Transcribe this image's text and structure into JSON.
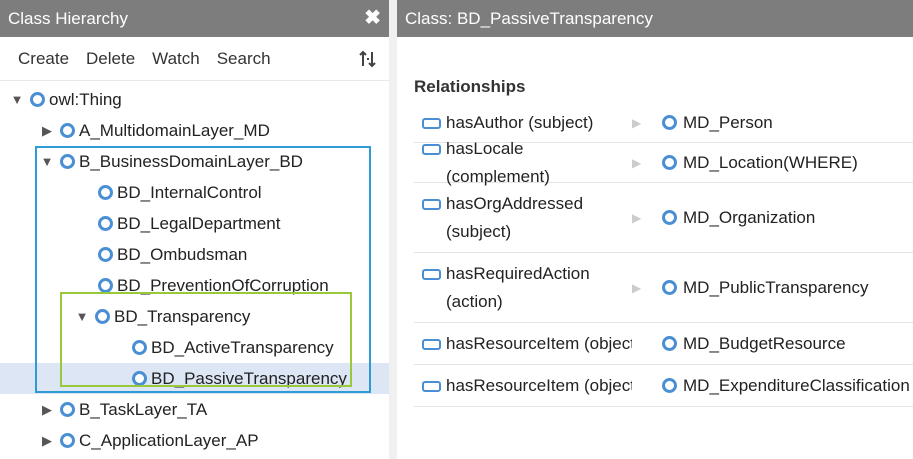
{
  "left_panel": {
    "title": "Class Hierarchy",
    "close_symbol": "✖",
    "toolbar": [
      "Create",
      "Delete",
      "Watch",
      "Search"
    ],
    "tree": [
      {
        "label": "owl:Thing",
        "toggle": "▼"
      },
      {
        "label": "A_MultidomainLayer_MD",
        "toggle": "▶"
      },
      {
        "label": "B_BusinessDomainLayer_BD",
        "toggle": "▼"
      },
      {
        "label": "BD_InternalControl",
        "toggle": ""
      },
      {
        "label": "BD_LegalDepartment",
        "toggle": ""
      },
      {
        "label": "BD_Ombudsman",
        "toggle": ""
      },
      {
        "label": "BD_PreventionOfCorruption",
        "toggle": ""
      },
      {
        "label": "BD_Transparency",
        "toggle": "▼"
      },
      {
        "label": "BD_ActiveTransparency",
        "toggle": ""
      },
      {
        "label": "BD_PassiveTransparency",
        "toggle": "",
        "selected": true
      },
      {
        "label": "B_TaskLayer_TA",
        "toggle": "▶"
      },
      {
        "label": "C_ApplicationLayer_AP",
        "toggle": "▶"
      }
    ]
  },
  "right_panel": {
    "title": "Class: BD_PassiveTransparency",
    "section_title": "Relationships",
    "relations": [
      {
        "property": "hasAuthor (subject)",
        "target": "MD_Person"
      },
      {
        "property": "hasLocale (complement)",
        "target": "MD_Location(WHERE)"
      },
      {
        "property": "hasOrgAddressed (subject)",
        "target": "MD_Organization"
      },
      {
        "property": "hasRequiredAction (action)",
        "target": "MD_PublicTransparency"
      },
      {
        "property": "hasResourceItem (object)",
        "target": "MD_BudgetResource"
      },
      {
        "property": "hasResourceItem (object)",
        "target": "MD_ExpenditureClassification"
      }
    ]
  },
  "colors": {
    "titlebar": "#7d7d7d",
    "icon_blue": "#4a8fd4",
    "highlight_blue": "#2e9bd6",
    "highlight_green": "#99c93a",
    "selected_row": "#dce6f5"
  }
}
